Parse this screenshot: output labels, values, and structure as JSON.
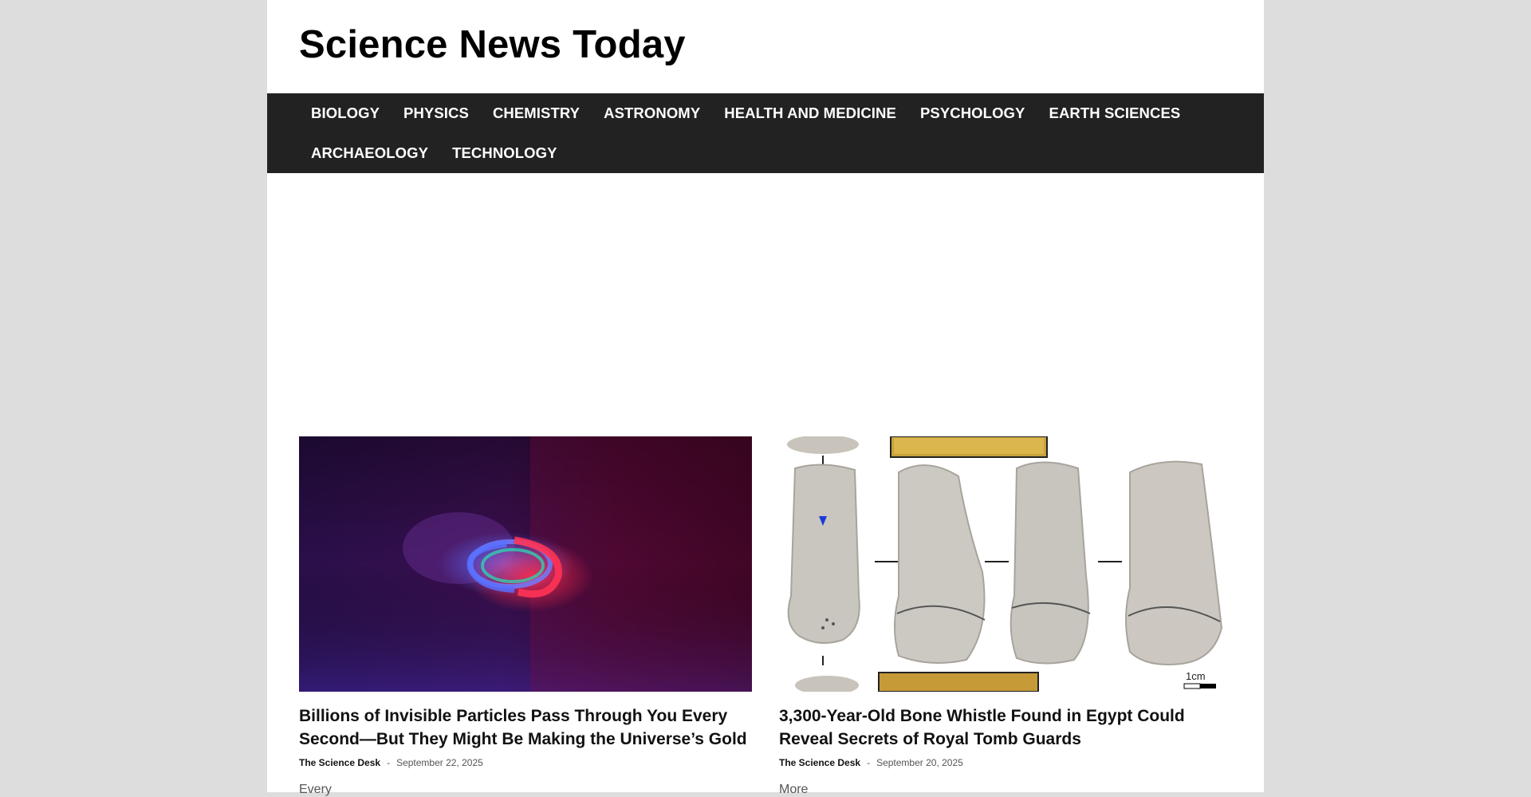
{
  "site": {
    "title": "Science News Today"
  },
  "nav": {
    "items": [
      {
        "label": "BIOLOGY"
      },
      {
        "label": "PHYSICS"
      },
      {
        "label": "CHEMISTRY"
      },
      {
        "label": "ASTRONOMY"
      },
      {
        "label": "HEALTH AND MEDICINE"
      },
      {
        "label": "PSYCHOLOGY"
      },
      {
        "label": "EARTH SCIENCES"
      },
      {
        "label": "ARCHAEOLOGY"
      },
      {
        "label": "TECHNOLOGY"
      }
    ]
  },
  "articles": [
    {
      "title": "Billions of Invisible Particles Pass Through You Every Second—But They Might Be Making the Universe’s Gold",
      "author": "The Science Desk",
      "separator": "-",
      "date": "September 22, 2025",
      "excerpt": "Every"
    },
    {
      "title": "3,300-Year-Old Bone Whistle Found in Egypt Could Reveal Secrets of Royal Tomb Guards",
      "author": "The Science Desk",
      "separator": "-",
      "date": "September 20, 2025",
      "excerpt": "More"
    }
  ],
  "image_labels": {
    "scale_bar": "1cm"
  }
}
